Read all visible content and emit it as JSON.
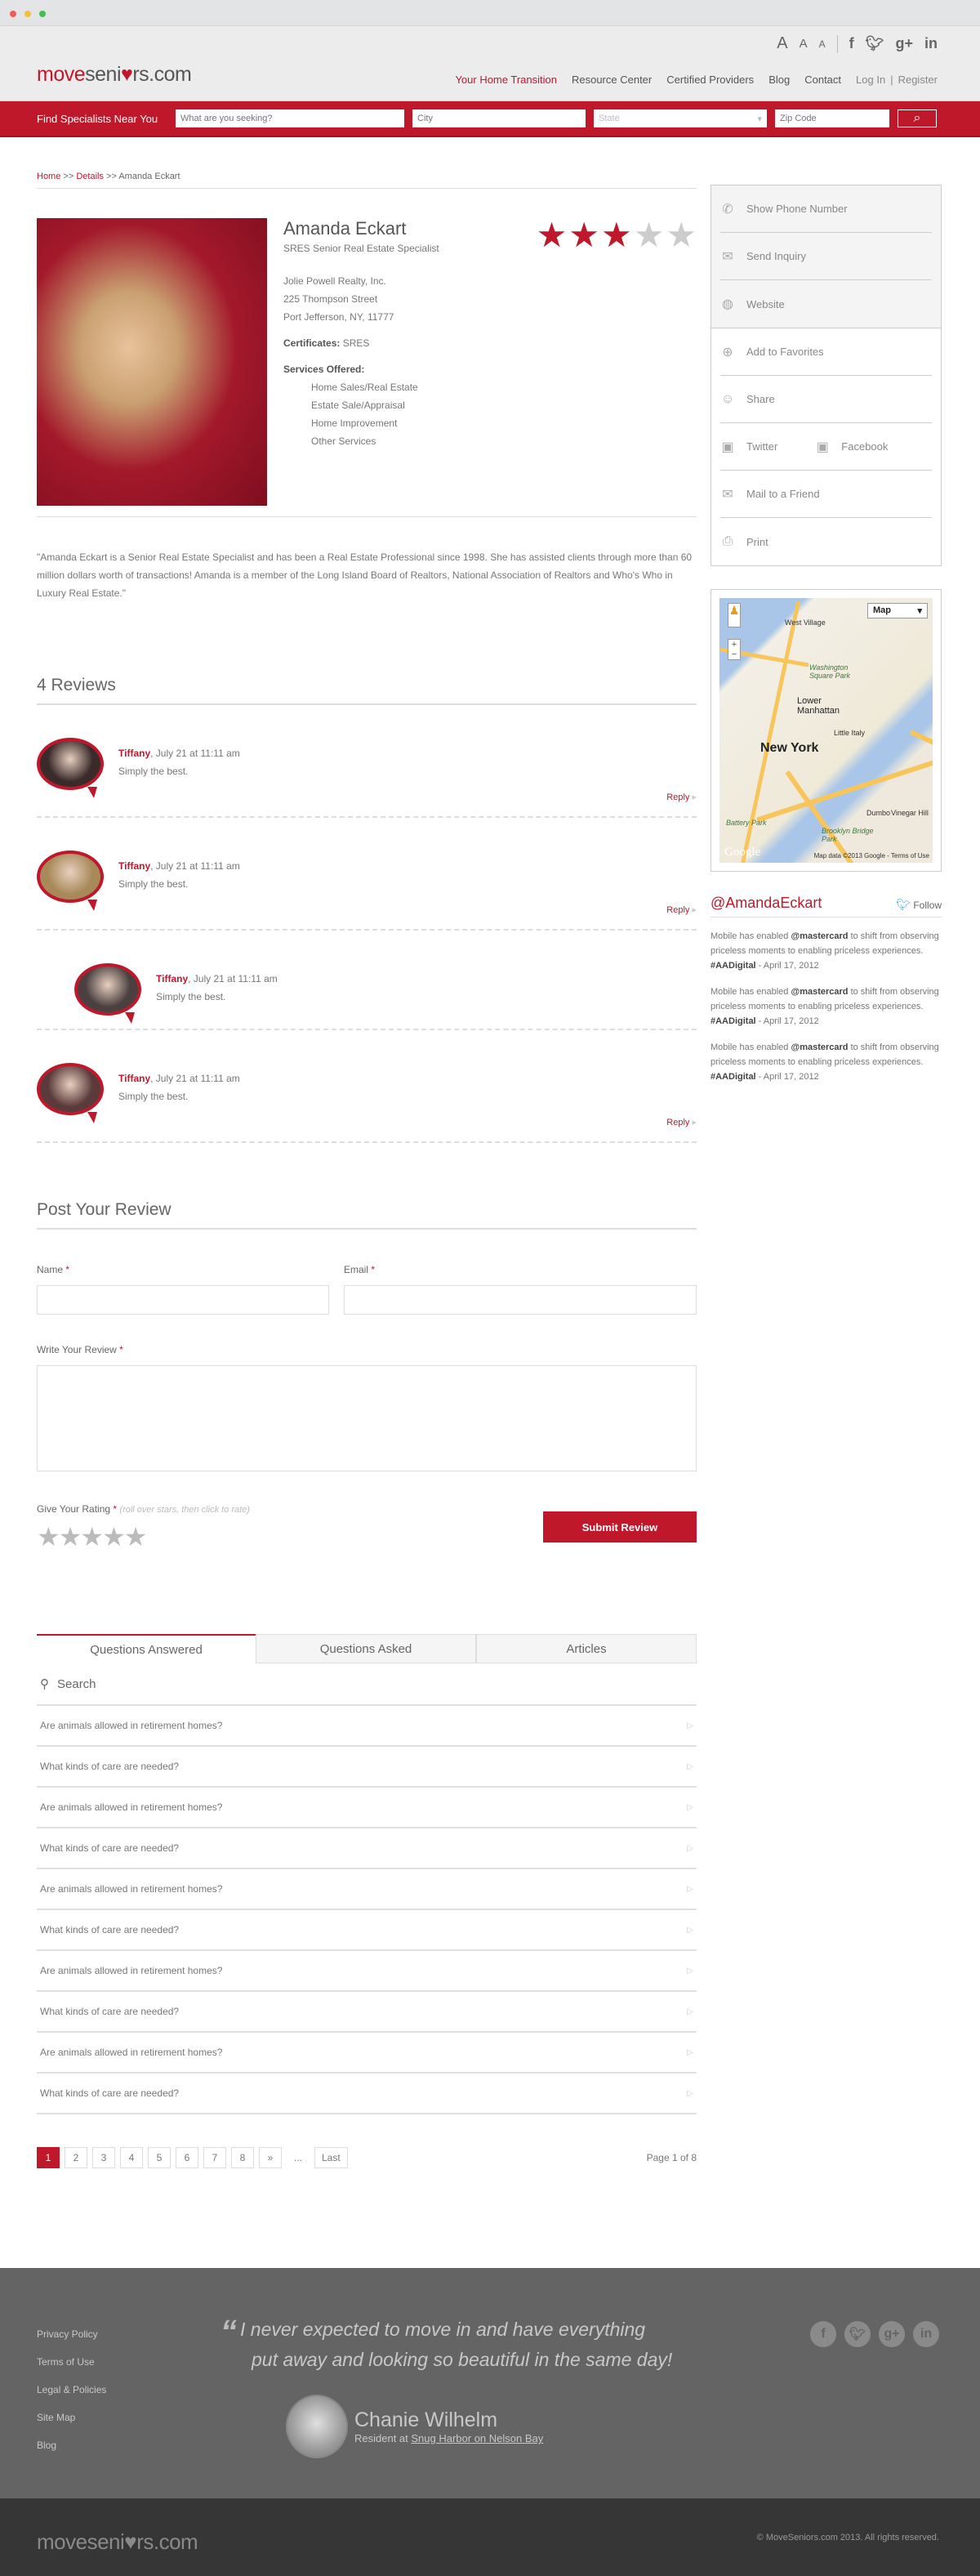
{
  "colors": {
    "brand_red": "#c0182b",
    "footer_bg": "#646464",
    "footer_bottom_bg": "#363636"
  },
  "header": {
    "logo": {
      "part1": "move",
      "part2": "seni",
      "heart": "♥",
      "part3": "rs.com"
    },
    "font_size_controls": [
      "A",
      "A",
      "A"
    ],
    "social_icons": [
      "f",
      "t",
      "g+",
      "in"
    ],
    "nav": [
      {
        "label": "Your Home Transition",
        "active": true
      },
      {
        "label": "Resource Center"
      },
      {
        "label": "Certified Providers"
      },
      {
        "label": "Blog"
      },
      {
        "label": "Contact"
      }
    ],
    "login": "Log In",
    "separator": "|",
    "register": "Register"
  },
  "search": {
    "label": "Find Specialists Near You",
    "seeking_placeholder": "What are you seeking?",
    "city_placeholder": "City",
    "state_placeholder": "State",
    "zip_placeholder": "Zip Code",
    "button_icon": "search-icon"
  },
  "breadcrumb": {
    "home": "Home",
    "sep": ">>",
    "details": "Details",
    "current": "Amanda Eckart"
  },
  "profile": {
    "name": "Amanda Eckart",
    "title": "SRES Senior Real Estate Specialist",
    "company": "Jolie Powell Realty, Inc.",
    "street": "225 Thompson Street",
    "city_line": "Port Jefferson, NY, 11777",
    "certificates_label": "Certificates:",
    "certificates_value": "SRES",
    "services_label": "Services Offered:",
    "services": [
      "Home Sales/Real Estate",
      "Estate Sale/Appraisal",
      "Home Improvement",
      "Other Services"
    ],
    "rating": 3,
    "rating_max": 5,
    "bio": "\"Amanda Eckart is a Senior Real Estate Specialist and has been a Real Estate Professional since 1998. She has assisted clients through more than 60 million dollars worth of transactions! Amanda is a member of the Long Island Board of Realtors, National Association of Realtors and Who's Who in Luxury Real Estate.\""
  },
  "reviews": {
    "heading": "4 Reviews",
    "items": [
      {
        "name": "Tiffany",
        "date": ", July 21 at 11:11 am",
        "text": "Simply the best.",
        "reply": "Reply",
        "nested": false
      },
      {
        "name": "Tiffany",
        "date": ", July 21 at 11:11 am",
        "text": "Simply the best.",
        "reply": "Reply",
        "nested": false
      },
      {
        "name": "Tiffany",
        "date": ", July 21 at 11:11 am",
        "text": "Simply the best.",
        "reply": "",
        "nested": true
      },
      {
        "name": "Tiffany",
        "date": ", July 21 at 11:11 am",
        "text": "Simply the best.",
        "reply": "Reply",
        "nested": false
      }
    ]
  },
  "post_review": {
    "heading": "Post Your Review",
    "name_label": "Name",
    "email_label": "Email",
    "review_label": "Write Your Review",
    "required_mark": "*",
    "rating_label": "Give Your Rating",
    "rating_hint": "(roll over stars, then click to rate)",
    "rating_value": 0,
    "submit": "Submit Review"
  },
  "tabs": {
    "items": [
      "Questions Answered",
      "Questions Asked",
      "Articles"
    ],
    "active": 0,
    "search_label": "Search",
    "questions": [
      "Are animals allowed in retirement homes?",
      "What kinds of care are needed?",
      "Are animals allowed in retirement homes?",
      "What kinds of care are needed?",
      "Are animals allowed in retirement homes?",
      "What kinds of care are needed?",
      "Are animals allowed in retirement homes?",
      "What kinds of care are needed?",
      "Are animals allowed in retirement homes?",
      "What kinds of care are needed?"
    ]
  },
  "pagination": {
    "pages": [
      "1",
      "2",
      "3",
      "4",
      "5",
      "6",
      "7",
      "8"
    ],
    "current": 1,
    "next": "»",
    "ellipsis": "...",
    "last": "Last",
    "info": "Page 1 of 8"
  },
  "sidebar": {
    "primary_actions": [
      {
        "label": "Show Phone Number",
        "icon": "phone-icon",
        "glyph": "✆"
      },
      {
        "label": "Send Inquiry",
        "icon": "envelope-icon",
        "glyph": "✉"
      },
      {
        "label": "Website",
        "icon": "globe-icon",
        "glyph": "◍"
      }
    ],
    "secondary_actions": [
      {
        "label": "Add to Favorites",
        "icon": "plus-circle-icon",
        "glyph": "⊕"
      },
      {
        "label": "Share",
        "icon": "user-add-icon",
        "glyph": "👤"
      }
    ],
    "twitter_label": "Twitter",
    "facebook_label": "Facebook",
    "mail_friend": "Mail to a Friend",
    "print": "Print",
    "map": {
      "type_selector": "Map",
      "city_label": "New York",
      "neighborhoods": [
        "West Village",
        "Washington Square Park",
        "Lower Manhattan",
        "Little Italy",
        "Battery Park",
        "Brooklyn Bridge Park",
        "Dumbo",
        "Vinegar Hill"
      ],
      "logo": "Google",
      "attribution": "Map data ©2013 Google - Terms of Use"
    },
    "twitter": {
      "handle": "@AmandaEckart",
      "follow": "Follow",
      "tweets": [
        {
          "pre": "Mobile has enabled ",
          "mention": "@mastercard",
          "post": " to shift from observing priceless moments to enabling priceless experiences.",
          "tag": "#AADigital",
          "date": " - April 17, 2012"
        },
        {
          "pre": "Mobile has enabled ",
          "mention": "@mastercard",
          "post": " to shift from observing priceless moments to enabling priceless experiences.",
          "tag": "#AADigital",
          "date": " - April 17, 2012"
        },
        {
          "pre": "Mobile has enabled ",
          "mention": "@mastercard",
          "post": " to shift from observing priceless moments to enabling priceless experiences.",
          "tag": "#AADigital",
          "date": " - April 17, 2012"
        }
      ]
    }
  },
  "footer": {
    "links": [
      "Privacy Policy",
      "Terms of Use",
      "Legal & Policies",
      "Site Map",
      "Blog"
    ],
    "quote_line1": "I never expected to move in and have everything",
    "quote_line2": "put away and looking so beautiful in the same day!",
    "quote_mark": "“",
    "testimonial_name": "Chanie Wilhelm",
    "testimonial_prefix": "Resident at ",
    "testimonial_place": "Snug Harbor on Nelson Bay",
    "social": [
      "f",
      "t",
      "g+",
      "in"
    ],
    "logo": "moveseni♥rs.com",
    "copyright": "© MoveSeniors.com 2013. All rights reserved."
  }
}
